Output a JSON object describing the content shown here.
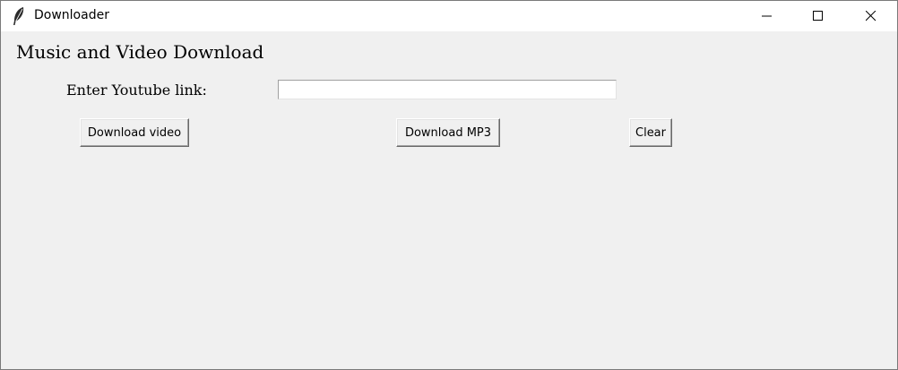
{
  "window": {
    "title": "Downloader",
    "icon": "feather-icon",
    "controls": [
      "minimize-icon",
      "maximize-icon",
      "close-icon"
    ]
  },
  "main": {
    "heading": "Music and Video Download",
    "link_label": "Enter Youtube link:",
    "link_value": "",
    "buttons": {
      "download_video": "Download video",
      "download_mp3": "Download MP3",
      "clear": "Clear"
    }
  }
}
